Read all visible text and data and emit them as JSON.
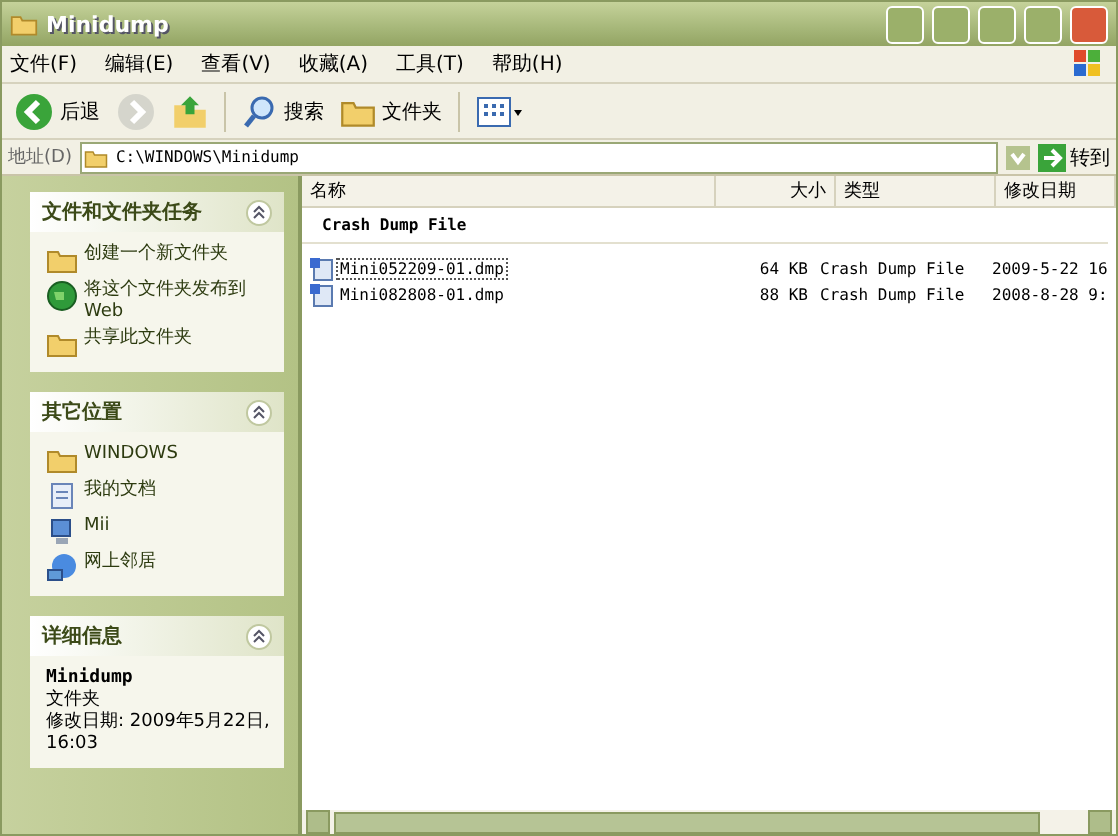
{
  "window": {
    "title": "Minidump"
  },
  "menu": [
    "文件(F)",
    "编辑(E)",
    "查看(V)",
    "收藏(A)",
    "工具(T)",
    "帮助(H)"
  ],
  "toolbar": {
    "back": "后退",
    "search": "搜索",
    "folders": "文件夹"
  },
  "address": {
    "label": "地址(D)",
    "value": "C:\\WINDOWS\\Minidump",
    "go": "转到"
  },
  "sidebar": [
    {
      "title": "文件和文件夹任务",
      "expanded": true,
      "items": [
        {
          "kind": "newfolder",
          "label": "创建一个新文件夹"
        },
        {
          "kind": "web",
          "label": "将这个文件夹发布到 Web"
        },
        {
          "kind": "share",
          "label": "共享此文件夹"
        }
      ]
    },
    {
      "title": "其它位置",
      "expanded": true,
      "items": [
        {
          "kind": "folder",
          "label": "WINDOWS"
        },
        {
          "kind": "docs",
          "label": "我的文档"
        },
        {
          "kind": "computer",
          "label": "Mii"
        },
        {
          "kind": "network",
          "label": "网上邻居"
        }
      ]
    },
    {
      "title": "详细信息",
      "expanded": true,
      "details": {
        "name": "Minidump",
        "type": "文件夹",
        "modified": "修改日期: 2009年5月22日, 16:03"
      }
    }
  ],
  "table": {
    "columns": [
      "名称",
      "大小",
      "类型",
      "修改日期"
    ],
    "group": "Crash Dump File",
    "rows": [
      {
        "name": "Mini052209-01.dmp",
        "size": "64 KB",
        "type": "Crash Dump File",
        "date": "2009-5-22 16",
        "focused": true
      },
      {
        "name": "Mini082808-01.dmp",
        "size": "88 KB",
        "type": "Crash Dump File",
        "date": "2008-8-28 9:",
        "focused": false
      }
    ]
  }
}
